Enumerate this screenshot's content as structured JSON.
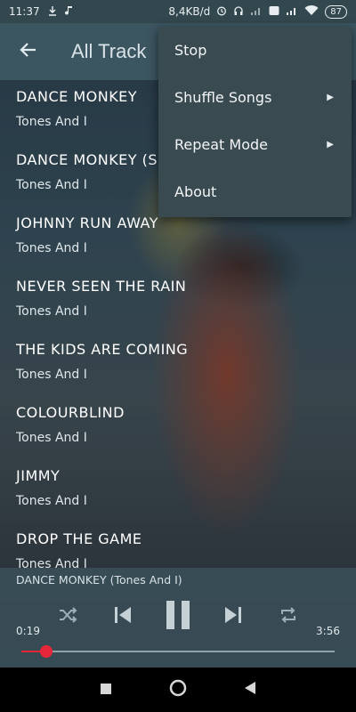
{
  "status_bar": {
    "time": "11:37",
    "net_speed": "8,4KB/d",
    "battery": "87"
  },
  "app_bar": {
    "title": "All Track"
  },
  "menu": {
    "items": [
      {
        "label": "Stop",
        "has_submenu": false
      },
      {
        "label": "Shuffle Songs",
        "has_submenu": true
      },
      {
        "label": "Repeat Mode",
        "has_submenu": true
      },
      {
        "label": "About",
        "has_submenu": false
      }
    ]
  },
  "tracks": [
    {
      "title": "DANCE MONKEY",
      "artist": "Tones And I"
    },
    {
      "title": "DANCE MONKEY (S",
      "artist": "Tones And I"
    },
    {
      "title": "JOHNNY RUN AWAY",
      "artist": "Tones And I"
    },
    {
      "title": "NEVER SEEN THE RAIN",
      "artist": "Tones And I"
    },
    {
      "title": "THE KIDS ARE COMING",
      "artist": "Tones And I"
    },
    {
      "title": "COLOURBLIND",
      "artist": "Tones And I"
    },
    {
      "title": "JIMMY",
      "artist": "Tones And I"
    },
    {
      "title": "DROP THE GAME",
      "artist": "Tones And I"
    }
  ],
  "player": {
    "now_playing": "DANCE MONKEY (Tones And I)",
    "elapsed": "0:19",
    "duration": "3:56",
    "progress_fraction": 0.08
  },
  "colors": {
    "accent": "#e8263a",
    "appbar": "#3c5661",
    "menu_bg": "#3a4a51"
  }
}
